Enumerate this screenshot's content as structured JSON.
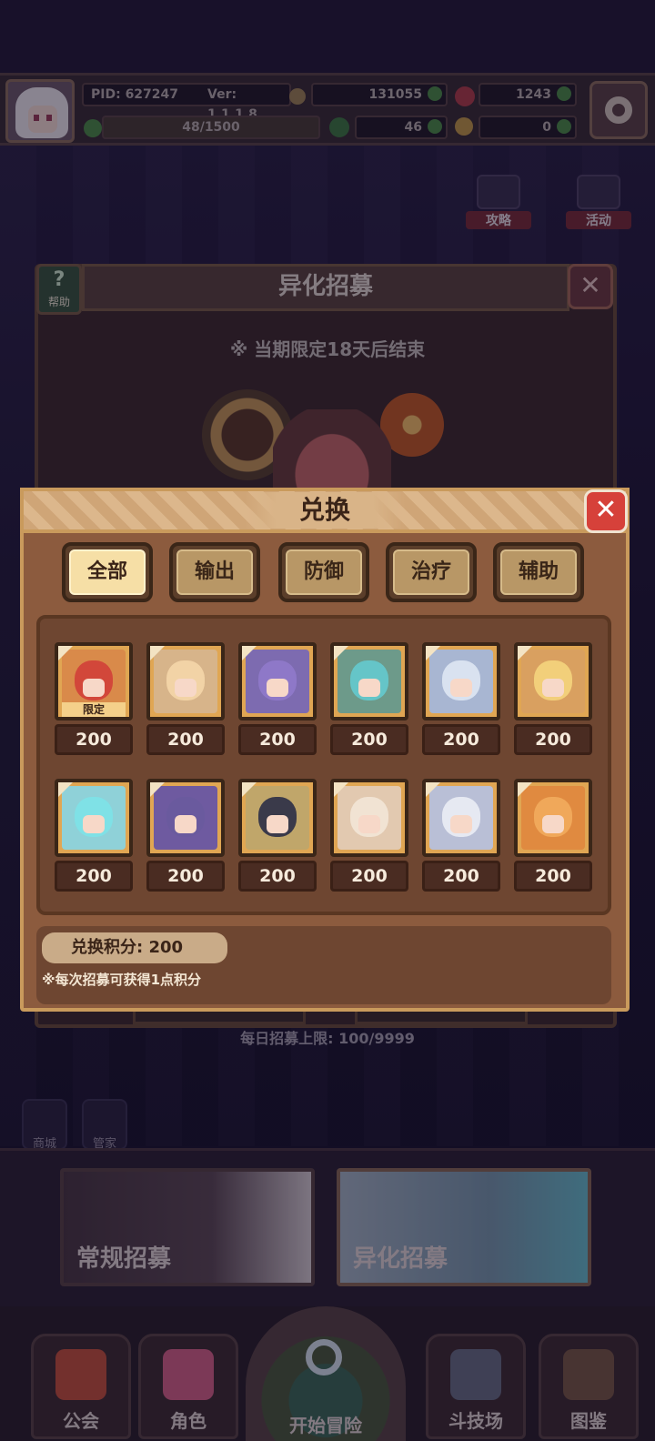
{
  "status": {
    "pid": "PID: 627247",
    "version": "Ver: 1.1.1.8",
    "gold": "131055",
    "gems": "1243",
    "stamina": "48/1500",
    "clover": "46",
    "keys": "0"
  },
  "side_buttons": {
    "guide": "攻略",
    "event": "活动"
  },
  "recruit": {
    "help": "帮助",
    "title": "异化招募",
    "limited_note": "※ 当期限定18天后结束",
    "daily_limit": "每日招募上限: 100/9999"
  },
  "exchange": {
    "title": "兑换",
    "tabs": [
      {
        "label": "全部",
        "active": true
      },
      {
        "label": "输出",
        "active": false
      },
      {
        "label": "防御",
        "active": false
      },
      {
        "label": "治疗",
        "active": false
      },
      {
        "label": "辅助",
        "active": false
      }
    ],
    "heroes": [
      {
        "price": "200",
        "tag": "限定",
        "bg": "#d98a4a",
        "hair": "#d2473a"
      },
      {
        "price": "200",
        "tag": "",
        "bg": "#d7b48a",
        "hair": "#f2d3a6"
      },
      {
        "price": "200",
        "tag": "",
        "bg": "#7d6bb0",
        "hair": "#8e78c8"
      },
      {
        "price": "200",
        "tag": "",
        "bg": "#6d9a8a",
        "hair": "#65c5c8"
      },
      {
        "price": "200",
        "tag": "",
        "bg": "#a8b6d2",
        "hair": "#d9e2f0"
      },
      {
        "price": "200",
        "tag": "",
        "bg": "#d9a060",
        "hair": "#f2cf7a"
      },
      {
        "price": "200",
        "tag": "",
        "bg": "#8fd1d8",
        "hair": "#7fe1e6"
      },
      {
        "price": "200",
        "tag": "",
        "bg": "#6e5aa0",
        "hair": "#6a5a9e"
      },
      {
        "price": "200",
        "tag": "",
        "bg": "#c0a66a",
        "hair": "#3a3a4a"
      },
      {
        "price": "200",
        "tag": "",
        "bg": "#e2c9b0",
        "hair": "#f1e3d3"
      },
      {
        "price": "200",
        "tag": "",
        "bg": "#b9bfd6",
        "hair": "#e6e9f2"
      },
      {
        "price": "200",
        "tag": "",
        "bg": "#e08a40",
        "hair": "#f0a85a"
      }
    ],
    "points_label": "兑换积分: 200",
    "points_note": "※每次招募可获得1点积分"
  },
  "mini_buttons": {
    "shop": "商城",
    "butler": "管家"
  },
  "banners": {
    "normal": "常规招募",
    "alien": "异化招募"
  },
  "nav": {
    "guild": "公会",
    "roles": "角色",
    "adventure": "开始冒险",
    "arena": "斗技场",
    "codex": "图鉴"
  },
  "colors": {
    "dialog": "#8c5b3e",
    "close_red": "#d6413a",
    "tab_active": "#f6dfa6"
  }
}
